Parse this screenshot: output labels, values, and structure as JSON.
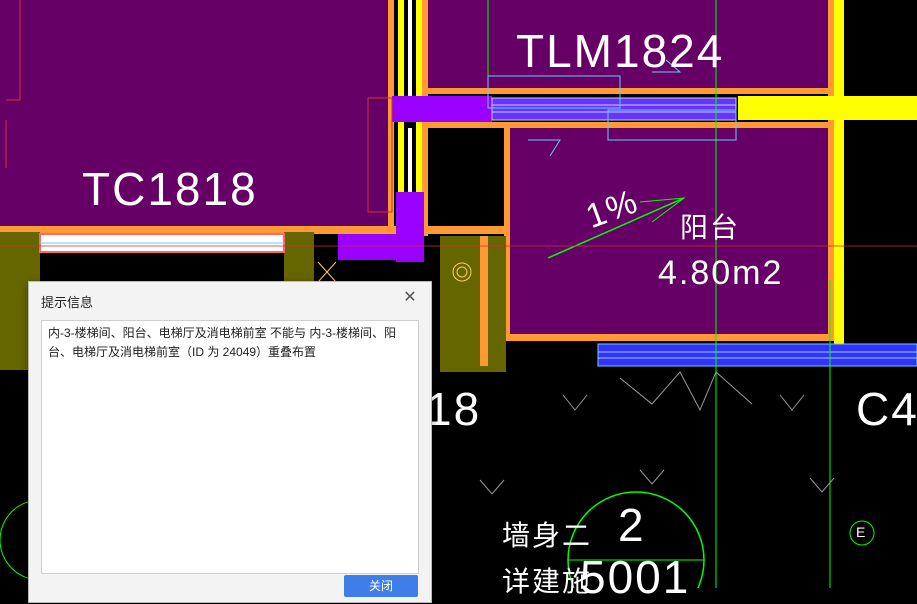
{
  "drawing": {
    "labels": {
      "window_tc": "TC1818",
      "door_tlm": "TLM1824",
      "slope": "1%",
      "room_name": "阳台",
      "room_area": "4.80m2",
      "partial_18": "18",
      "partial_c4": "C4",
      "wall_text_1": "墙身二",
      "wall_text_2": "详建施",
      "detail_number": "2",
      "detail_sheet": "5001",
      "axis_e": "E"
    },
    "colors": {
      "background": "#000000",
      "room_fill": "#660066",
      "wall_orange": "#ff9933",
      "wall_yellow": "#ffff00",
      "column_purple": "#9900ff",
      "olive": "#666600",
      "green_line": "#00ff00",
      "blue_window": "#3333ff",
      "cyan": "#66ccff"
    }
  },
  "dialog": {
    "title": "提示信息",
    "message": "内-3-楼梯间、阳台、电梯厅及消电梯前室 不能与 内-3-楼梯间、阳台、电梯厅及消电梯前室（ID 为 24049）重叠布置",
    "close_icon": "close-icon",
    "close_button_label": "关闭"
  }
}
